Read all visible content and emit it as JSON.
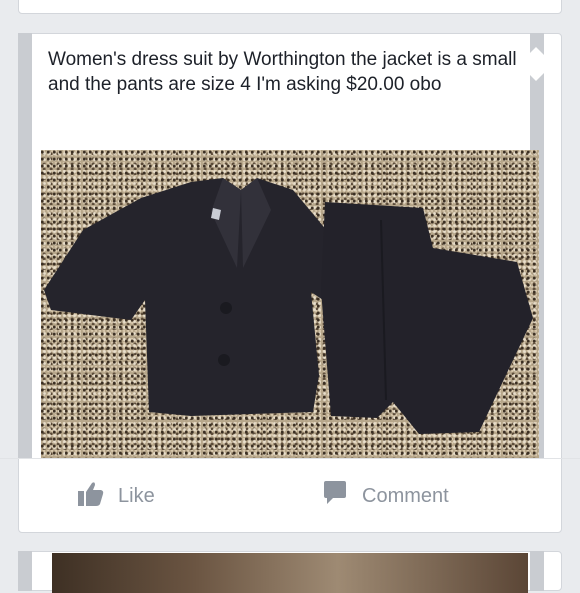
{
  "post": {
    "text": "Women's dress suit by Worthington the jacket is a small and the pants are size 4 I'm asking $20.00 obo",
    "photo_icon": "suit-photo"
  },
  "actions": {
    "like_label": "Like",
    "comment_label": "Comment",
    "like_icon": "thumbs-up-icon",
    "comment_icon": "comment-bubble-icon"
  },
  "colors": {
    "background": "#e9ebee",
    "card": "#ffffff",
    "text": "#1d2129",
    "muted": "#8d949e"
  }
}
